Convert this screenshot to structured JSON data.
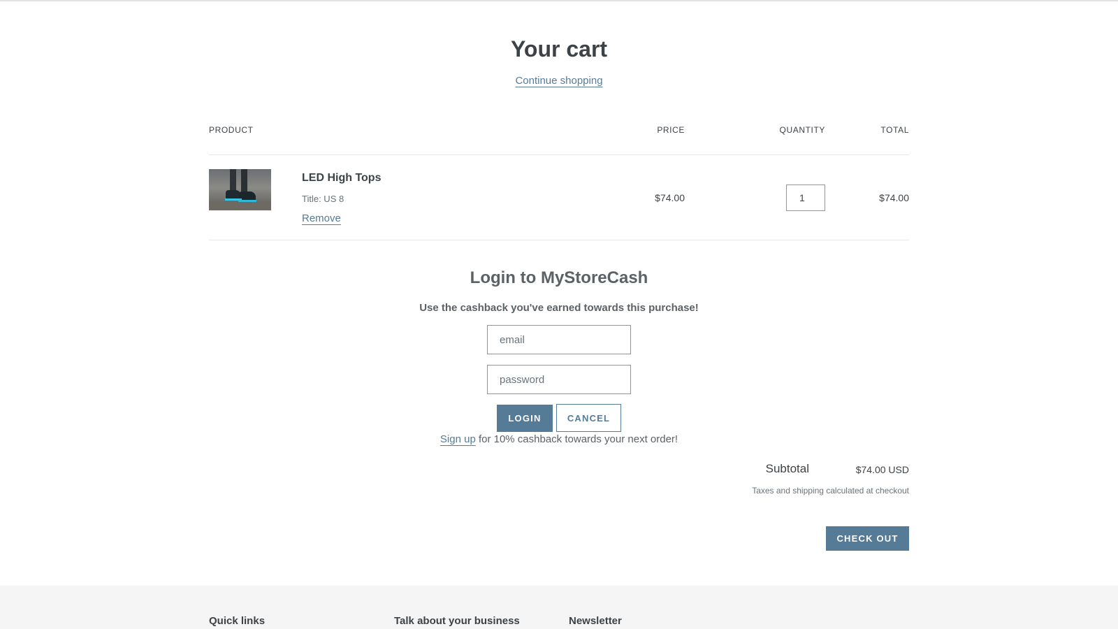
{
  "cart": {
    "title": "Your cart",
    "continue_label": "Continue shopping"
  },
  "table": {
    "headers": {
      "product": "PRODUCT",
      "price": "PRICE",
      "quantity": "QUANTITY",
      "total": "TOTAL"
    },
    "items": [
      {
        "name": "LED High Tops",
        "variant": "Title: US 8",
        "remove_label": "Remove",
        "price": "$74.00",
        "quantity": "1",
        "total": "$74.00",
        "image_icon": "product-thumbnail-shoes"
      }
    ]
  },
  "login": {
    "title": "Login to MyStoreCash",
    "subtitle": "Use the cashback you've earned towards this purchase!",
    "email_placeholder": "email",
    "password_placeholder": "password",
    "login_label": "LOGIN",
    "cancel_label": "CANCEL",
    "signup_link": "Sign up",
    "signup_text": " for 10% cashback towards your next order!"
  },
  "summary": {
    "subtotal_label": "Subtotal",
    "subtotal_value": "$74.00 USD",
    "tax_note": "Taxes and shipping calculated at checkout",
    "checkout_label": "CHECK OUT"
  },
  "footer": {
    "columns": [
      "Quick links",
      "Talk about your business",
      "Newsletter"
    ]
  },
  "colors": {
    "accent": "#557b97",
    "text": "#3d4246",
    "footer_bg": "#f5f5f5"
  }
}
